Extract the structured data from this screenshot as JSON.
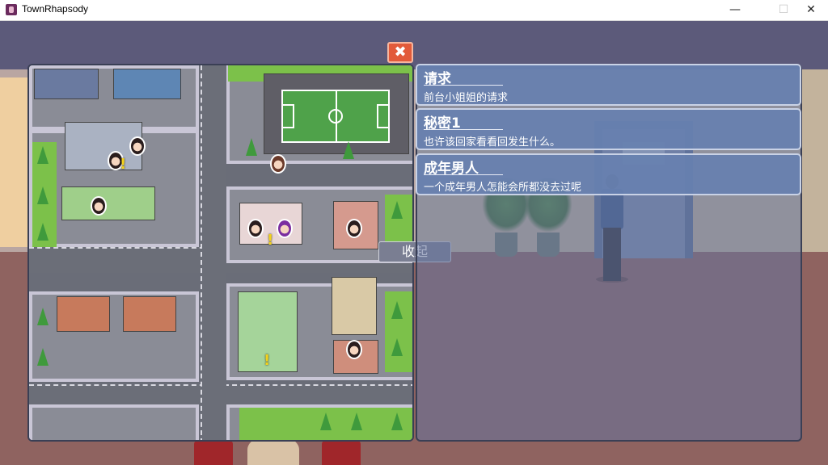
{
  "window": {
    "title": "TownRhapsody",
    "minimize_glyph": "—",
    "maximize_glyph": "☐",
    "close_glyph": "✕"
  },
  "map": {
    "close_glyph": "✖",
    "collapse_label": "收起",
    "markers": [
      {
        "type": "character",
        "color": "dark-hair"
      },
      {
        "type": "character",
        "color": "dark-hair"
      },
      {
        "type": "character",
        "color": "brown-hair"
      },
      {
        "type": "character",
        "color": "dark-hair"
      },
      {
        "type": "character",
        "color": "dark-hair"
      },
      {
        "type": "character",
        "color": "purple-hair"
      },
      {
        "type": "character",
        "color": "dark-hair"
      },
      {
        "type": "character",
        "color": "dark-hair"
      }
    ],
    "alerts_glyph": "!"
  },
  "quests": [
    {
      "title": "请求",
      "description": "前台小姐姐的请求"
    },
    {
      "title": "秘密1",
      "description": "也许该回家看看回发生什么。"
    },
    {
      "title": "成年男人",
      "description": "一个成年男人怎能会所都没去过呢"
    }
  ],
  "colors": {
    "accent_close": "#e25a3a",
    "quest_bg": "#6780b0",
    "alert": "#f3d21c"
  }
}
